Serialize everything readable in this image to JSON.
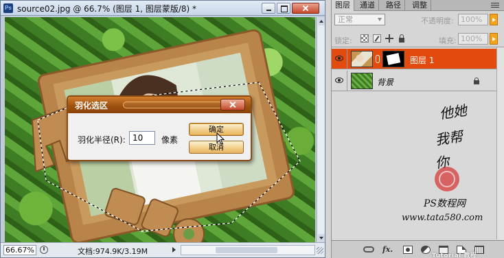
{
  "document": {
    "title": "source02.jpg @ 66.7% (图层 1, 图层蒙版/8) *",
    "app_icon": "Ps",
    "zoom": "66.67%",
    "doc_info": "文档:974.9K/3.19M"
  },
  "feather_dialog": {
    "title": "羽化选区",
    "radius_label": "羽化半径(R):",
    "radius_value": "10",
    "unit": "像素",
    "ok_label": "确定",
    "cancel_label": "取消"
  },
  "layers_panel": {
    "tabs": [
      "图层",
      "通道",
      "路径",
      "调整"
    ],
    "blend_mode": "正常",
    "opacity_label": "不透明度:",
    "opacity_value": "100%",
    "lock_label": "锁定:",
    "fill_label": "填充:",
    "fill_value": "100%",
    "layers": [
      {
        "name": "图层 1",
        "selected": true,
        "has_mask": true
      },
      {
        "name": "背景",
        "selected": false,
        "locked": true
      }
    ],
    "toolbar_icons": [
      "link-layers-icon",
      "fx-icon",
      "add-mask-icon",
      "adjust-layer-icon",
      "new-group-icon",
      "new-layer-icon",
      "delete-layer-icon"
    ]
  },
  "watermark": {
    "line1": "他她",
    "line2": "我帮",
    "line3": "你",
    "site_name": "PS数程网",
    "url": "www.tata580.com",
    "bottom_mark": "Tutorial 教程"
  },
  "colors": {
    "selected_layer": "#e24a0e",
    "dialog_title": "#9e520f",
    "button_gold": "#f2cf8a",
    "accent_orange": "#f5a318"
  }
}
